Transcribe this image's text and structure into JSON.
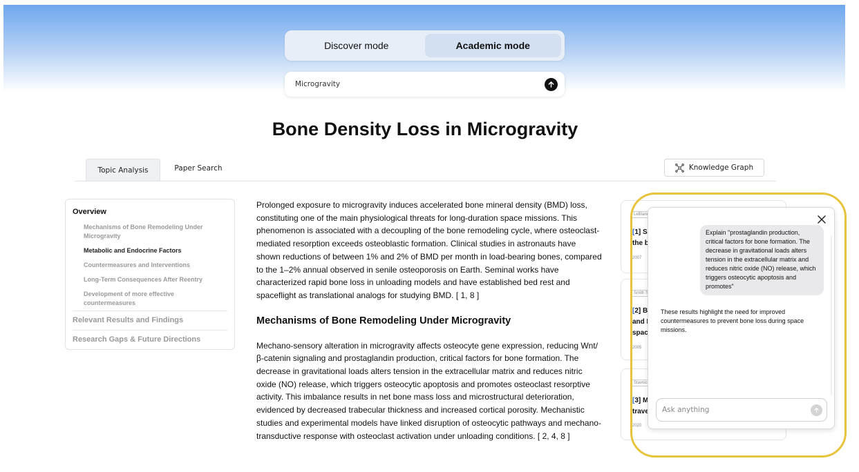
{
  "modes": {
    "discover_label": "Discover mode",
    "academic_label": "Academic mode",
    "active": "academic"
  },
  "search": {
    "value": "Microgravity",
    "send_icon": "arrow-up-icon"
  },
  "page_title": "Bone Density Loss in Microgravity",
  "tabs": [
    {
      "label": "Topic Analysis",
      "active": true
    },
    {
      "label": "Paper Search",
      "active": false
    }
  ],
  "knowledge_graph": {
    "label": "Knowledge Graph",
    "icon": "graph-nodes-icon"
  },
  "toc": {
    "overview": "Overview",
    "subitems": [
      "Mechanisms of Bone Remodeling Under Microgravity",
      "Metabolic and Endocrine Factors",
      "Countermeasures and Interventions",
      "Long-Term Consequences After Reentry",
      "Development of more effective countermeasures"
    ],
    "current_subitem": "Metabolic and Endocrine Factors",
    "sections": [
      "Relevant Results and Findings",
      "Research Gaps & Future Directions"
    ]
  },
  "article": {
    "intro": "Prolonged exposure to microgravity induces accelerated bone mineral density (BMD) loss, constituting one of the main physiological threats for long-duration space missions. This phenomenon is associated with a decoupling of the bone remodeling cycle, where osteoclast-mediated resorption exceeds osteoblastic formation. Clinical studies in astronauts have shown reductions of between 1% and 2% of BMD per month in load-bearing bones, compared to the 1–2% annual observed in senile osteoporosis on Earth. Seminal works have characterized rapid bone loss in unloading models and have established bed rest and spaceflight as translational analogs for studying BMD. [ 1, 8 ]",
    "section_title": "Mechanisms of Bone Remodeling Under Microgravity",
    "section_body": "Mechano-sensory alteration in microgravity affects osteocyte gene expression, reducing Wnt/β-catenin signaling and prostaglandin production, critical factors for bone formation. The decrease in gravitational loads alters tension in the extracellular matrix and reduces nitric oxide (NO) release, which triggers osteocytic apoptosis and promotes osteoclast resorptive activity. This imbalance results in net bone mass loss and microstructural deterioration, evidenced by decreased trabecular thickness and increased cortical porosity. Mechanistic studies and experimental models have linked disruption of osteocytic pathways and mechano-transductive response with osteoclast activation under unloading conditions. [ 2, 4, 8 ]"
  },
  "references": [
    {
      "tag": "LeBlanc",
      "num": "1]",
      "line1": "S",
      "line2": "the b",
      "year": "2007"
    },
    {
      "tag": "Smith S",
      "num": "2]",
      "line1": "B",
      "line2": "and I",
      "line3": "spac",
      "year": "2005"
    },
    {
      "tag": "Stavnic",
      "num": "3]",
      "line1": "M",
      "line2": "trave",
      "year": "2020"
    }
  ],
  "chat": {
    "user_message": "Explain \"prostaglandin production, critical factors for bone formation. The decrease in gravitational loads alters tension in the extracellular matrix and reduces nitric oxide (NO) release, which triggers osteocytic apoptosis and promotes\"",
    "assistant_message": "These results highlight the need for improved countermeasures to prevent bone loss during space missions.",
    "input_placeholder": "Ask anything",
    "highlight_color": "#e8c33c"
  }
}
